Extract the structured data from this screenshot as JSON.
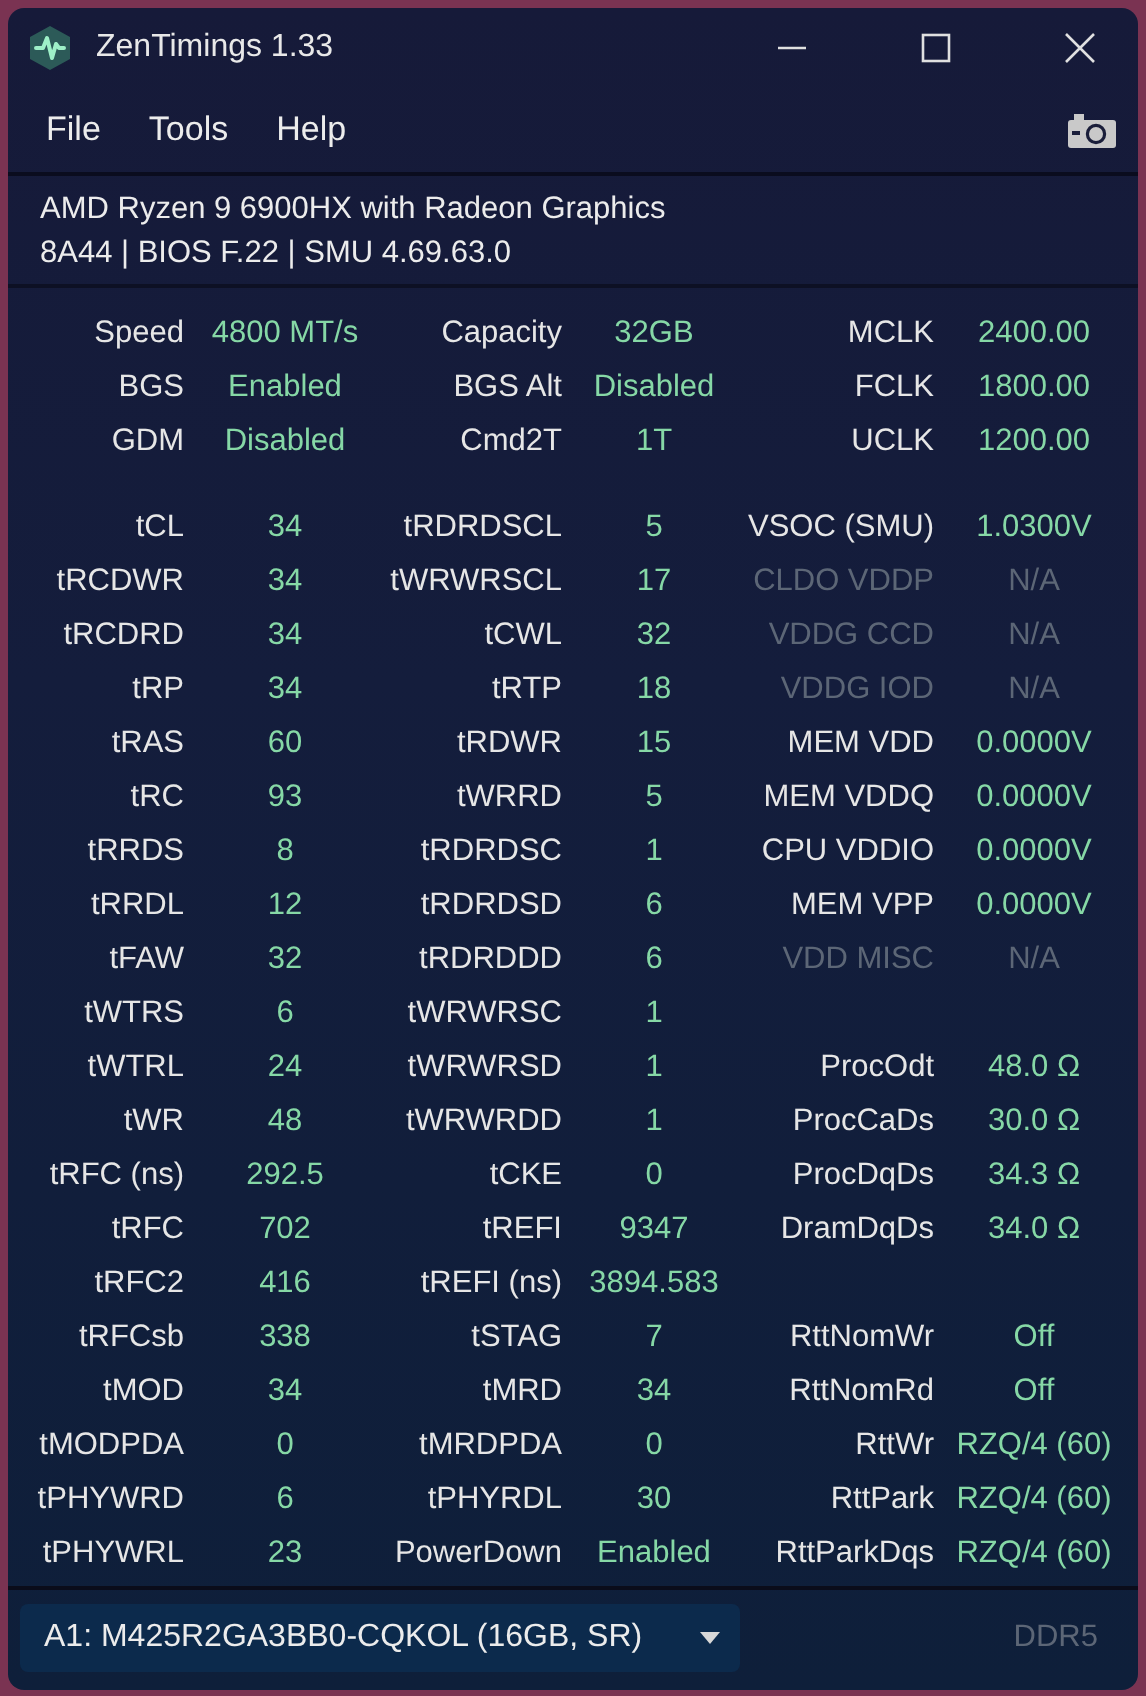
{
  "window": {
    "title": "ZenTimings 1.33"
  },
  "menu": [
    "File",
    "Tools",
    "Help"
  ],
  "system": {
    "cpu": "AMD Ryzen 9 6900HX with Radeon Graphics",
    "board": "8A44 | BIOS F.22 | SMU 4.69.63.0"
  },
  "summary": [
    [
      {
        "label": "Speed",
        "value": "4800 MT/s",
        "disabled": false
      },
      {
        "label": "Capacity",
        "value": "32GB",
        "disabled": false
      },
      {
        "label": "MCLK",
        "value": "2400.00",
        "disabled": false
      }
    ],
    [
      {
        "label": "BGS",
        "value": "Enabled",
        "disabled": false
      },
      {
        "label": "BGS Alt",
        "value": "Disabled",
        "disabled": false
      },
      {
        "label": "FCLK",
        "value": "1800.00",
        "disabled": false
      }
    ],
    [
      {
        "label": "GDM",
        "value": "Disabled",
        "disabled": false
      },
      {
        "label": "Cmd2T",
        "value": "1T",
        "disabled": false
      },
      {
        "label": "UCLK",
        "value": "1200.00",
        "disabled": false
      }
    ]
  ],
  "timings": [
    [
      {
        "label": "tCL",
        "value": "34",
        "disabled": false
      },
      {
        "label": "tRDRDSCL",
        "value": "5",
        "disabled": false
      },
      {
        "label": "VSOC (SMU)",
        "value": "1.0300V",
        "disabled": false
      }
    ],
    [
      {
        "label": "tRCDWR",
        "value": "34",
        "disabled": false
      },
      {
        "label": "tWRWRSCL",
        "value": "17",
        "disabled": false
      },
      {
        "label": "CLDO VDDP",
        "value": "N/A",
        "disabled": true
      }
    ],
    [
      {
        "label": "tRCDRD",
        "value": "34",
        "disabled": false
      },
      {
        "label": "tCWL",
        "value": "32",
        "disabled": false
      },
      {
        "label": "VDDG CCD",
        "value": "N/A",
        "disabled": true
      }
    ],
    [
      {
        "label": "tRP",
        "value": "34",
        "disabled": false
      },
      {
        "label": "tRTP",
        "value": "18",
        "disabled": false
      },
      {
        "label": "VDDG IOD",
        "value": "N/A",
        "disabled": true
      }
    ],
    [
      {
        "label": "tRAS",
        "value": "60",
        "disabled": false
      },
      {
        "label": "tRDWR",
        "value": "15",
        "disabled": false
      },
      {
        "label": "MEM VDD",
        "value": "0.0000V",
        "disabled": false
      }
    ],
    [
      {
        "label": "tRC",
        "value": "93",
        "disabled": false
      },
      {
        "label": "tWRRD",
        "value": "5",
        "disabled": false
      },
      {
        "label": "MEM VDDQ",
        "value": "0.0000V",
        "disabled": false
      }
    ],
    [
      {
        "label": "tRRDS",
        "value": "8",
        "disabled": false
      },
      {
        "label": "tRDRDSC",
        "value": "1",
        "disabled": false
      },
      {
        "label": "CPU VDDIO",
        "value": "0.0000V",
        "disabled": false
      }
    ],
    [
      {
        "label": "tRRDL",
        "value": "12",
        "disabled": false
      },
      {
        "label": "tRDRDSD",
        "value": "6",
        "disabled": false
      },
      {
        "label": "MEM VPP",
        "value": "0.0000V",
        "disabled": false
      }
    ],
    [
      {
        "label": "tFAW",
        "value": "32",
        "disabled": false
      },
      {
        "label": "tRDRDDD",
        "value": "6",
        "disabled": false
      },
      {
        "label": "VDD MISC",
        "value": "N/A",
        "disabled": true
      }
    ],
    [
      {
        "label": "tWTRS",
        "value": "6",
        "disabled": false
      },
      {
        "label": "tWRWRSC",
        "value": "1",
        "disabled": false
      }
    ],
    [
      {
        "label": "tWTRL",
        "value": "24",
        "disabled": false
      },
      {
        "label": "tWRWRSD",
        "value": "1",
        "disabled": false
      },
      {
        "label": "ProcOdt",
        "value": "48.0 Ω",
        "disabled": false
      }
    ],
    [
      {
        "label": "tWR",
        "value": "48",
        "disabled": false
      },
      {
        "label": "tWRWRDD",
        "value": "1",
        "disabled": false
      },
      {
        "label": "ProcCaDs",
        "value": "30.0 Ω",
        "disabled": false
      }
    ],
    [
      {
        "label": "tRFC (ns)",
        "value": "292.5",
        "disabled": false
      },
      {
        "label": "tCKE",
        "value": "0",
        "disabled": false
      },
      {
        "label": "ProcDqDs",
        "value": "34.3 Ω",
        "disabled": false
      }
    ],
    [
      {
        "label": "tRFC",
        "value": "702",
        "disabled": false
      },
      {
        "label": "tREFI",
        "value": "9347",
        "disabled": false
      },
      {
        "label": "DramDqDs",
        "value": "34.0 Ω",
        "disabled": false
      }
    ],
    [
      {
        "label": "tRFC2",
        "value": "416",
        "disabled": false
      },
      {
        "label": "tREFI (ns)",
        "value": "3894.583",
        "disabled": false
      }
    ],
    [
      {
        "label": "tRFCsb",
        "value": "338",
        "disabled": false
      },
      {
        "label": "tSTAG",
        "value": "7",
        "disabled": false
      },
      {
        "label": "RttNomWr",
        "value": "Off",
        "disabled": false
      }
    ],
    [
      {
        "label": "tMOD",
        "value": "34",
        "disabled": false
      },
      {
        "label": "tMRD",
        "value": "34",
        "disabled": false
      },
      {
        "label": "RttNomRd",
        "value": "Off",
        "disabled": false
      }
    ],
    [
      {
        "label": "tMODPDA",
        "value": "0",
        "disabled": false
      },
      {
        "label": "tMRDPDA",
        "value": "0",
        "disabled": false
      },
      {
        "label": "RttWr",
        "value": "RZQ/4 (60)",
        "disabled": false
      }
    ],
    [
      {
        "label": "tPHYWRD",
        "value": "6",
        "disabled": false
      },
      {
        "label": "tPHYRDL",
        "value": "30",
        "disabled": false
      },
      {
        "label": "RttPark",
        "value": "RZQ/4 (60)",
        "disabled": false
      }
    ],
    [
      {
        "label": "tPHYWRL",
        "value": "23",
        "disabled": false
      },
      {
        "label": "PowerDown",
        "value": "Enabled",
        "disabled": false
      },
      {
        "label": "RttParkDqs",
        "value": "RZQ/4 (60)",
        "disabled": false
      }
    ]
  ],
  "footer": {
    "module": "A1: M425R2GA3BB0-CQKOL (16GB, SR)",
    "memory_type": "DDR5"
  }
}
